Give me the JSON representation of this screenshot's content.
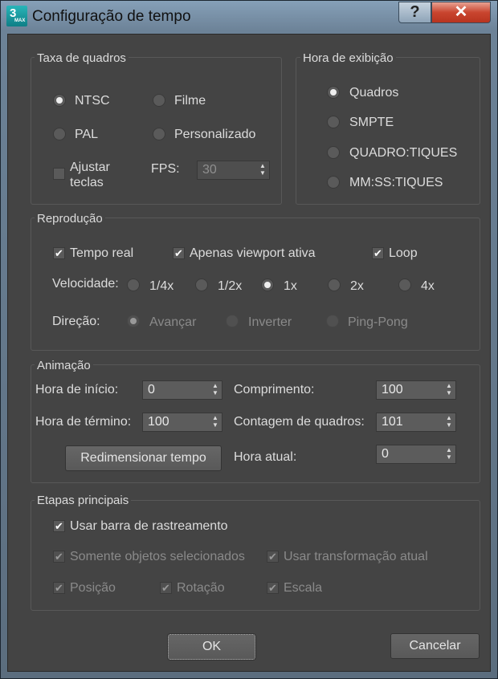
{
  "window": {
    "title": "Configuração de tempo",
    "help_label": "?",
    "close_label": "✕",
    "app_icon_text": "3",
    "app_icon_sub": "MAX"
  },
  "frame_rate": {
    "legend": "Taxa de quadros",
    "options": [
      {
        "label": "NTSC",
        "selected": true
      },
      {
        "label": "Filme",
        "selected": false
      },
      {
        "label": "PAL",
        "selected": false
      },
      {
        "label": "Personalizado",
        "selected": false
      }
    ],
    "adjust_keys_label": "Ajustar teclas",
    "adjust_keys_checked": false,
    "fps_label": "FPS:",
    "fps_value": "30"
  },
  "time_display": {
    "legend": "Hora de exibição",
    "options": [
      {
        "label": "Quadros",
        "selected": true
      },
      {
        "label": "SMPTE",
        "selected": false
      },
      {
        "label": "QUADRO:TIQUES",
        "selected": false
      },
      {
        "label": "MM:SS:TIQUES",
        "selected": false
      }
    ]
  },
  "playback": {
    "legend": "Reprodução",
    "real_time_label": "Tempo real",
    "active_viewport_label": "Apenas viewport ativa",
    "loop_label": "Loop",
    "speed_label": "Velocidade:",
    "speeds": [
      {
        "label": "1/4x",
        "selected": false
      },
      {
        "label": "1/2x",
        "selected": false
      },
      {
        "label": "1x",
        "selected": true
      },
      {
        "label": "2x",
        "selected": false
      },
      {
        "label": "4x",
        "selected": false
      }
    ],
    "direction_label": "Direção:",
    "directions": [
      {
        "label": "Avançar",
        "selected": true
      },
      {
        "label": "Inverter",
        "selected": false
      },
      {
        "label": "Ping-Pong",
        "selected": false
      }
    ]
  },
  "animation": {
    "legend": "Animação",
    "start_time_label": "Hora de início:",
    "start_time_value": "0",
    "end_time_label": "Hora de término:",
    "end_time_value": "100",
    "length_label": "Comprimento:",
    "length_value": "100",
    "frame_count_label": "Contagem de quadros:",
    "frame_count_value": "101",
    "current_time_label": "Hora atual:",
    "current_time_value": "0",
    "rescale_label": "Redimensionar tempo"
  },
  "key_steps": {
    "legend": "Etapas principais",
    "use_trackbar_label": "Usar barra de rastreamento",
    "selected_only_label": "Somente objetos selecionados",
    "use_current_transform_label": "Usar transformação atual",
    "position_label": "Posição",
    "rotation_label": "Rotação",
    "scale_label": "Escala"
  },
  "buttons": {
    "ok": "OK",
    "cancel": "Cancelar"
  }
}
